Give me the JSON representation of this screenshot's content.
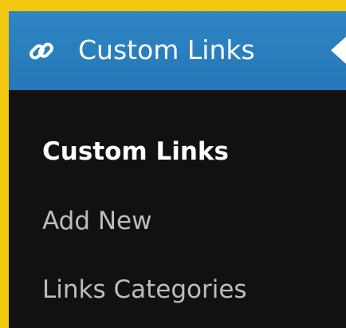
{
  "menu": {
    "title": "Custom Links",
    "icon": "link-icon",
    "accent_color": "#2577b6",
    "items": [
      {
        "label": "Custom Links",
        "current": true
      },
      {
        "label": "Add New",
        "current": false
      },
      {
        "label": "Links Categories",
        "current": false
      }
    ]
  }
}
